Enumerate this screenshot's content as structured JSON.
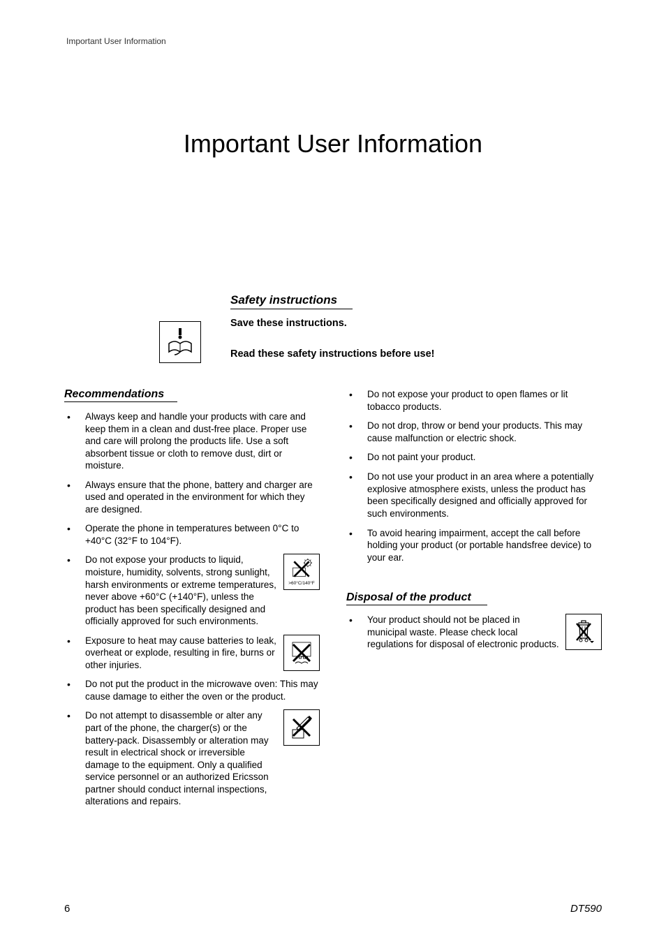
{
  "header": {
    "text": "Important User Information"
  },
  "title": "Important User Information",
  "safety": {
    "heading": "Safety instructions",
    "save": "Save these instructions.",
    "read": "Read these safety instructions before use!"
  },
  "icons": {
    "book": "book-warning-icon",
    "temp": "no-extreme-temperature-icon",
    "temp_caption": ">60°C/140°F",
    "heat": "no-heat-icon",
    "disassemble": "no-disassemble-icon",
    "bin": "crossed-out-bin-icon"
  },
  "recommendations": {
    "heading": "Recommendations",
    "items": [
      "Always keep and handle your products with care and keep them in a clean and dust-free place. Proper use and care will prolong the products life. Use a soft absorbent tissue or cloth to remove dust, dirt or moisture.",
      "Always ensure that the phone, battery and charger are used and operated in the environment for which they are designed.",
      "Operate the phone in temperatures between 0°C to +40°C (32°F to 104°F).",
      "Do not expose your products to liquid, moisture, humidity, solvents, strong sunlight, harsh environments or extreme temperatures, never above +60°C (+140°F), unless the product has been specifically designed and officially approved for such environments.",
      "Exposure to heat may cause batteries to leak, overheat or explode, resulting in fire, burns or other injuries.",
      "Do not put the product in the microwave oven: This may cause damage to either the oven or the product.",
      "Do not attempt to disassemble or alter any part of the phone, the charger(s) or the battery-pack. Disassembly or alteration may result in electrical shock or irreversible damage to the equipment. Only a qualified service personnel or an authorized Ericsson partner should conduct internal inspections, alterations and repairs."
    ]
  },
  "right_items": [
    "Do not expose your product to open flames or lit tobacco products.",
    "Do not drop, throw or bend your products. This may cause malfunction or electric shock.",
    "Do not paint your product.",
    "Do not use your product in an area where a potentially explosive atmosphere exists, unless the product has been specifically designed and officially approved for such environments.",
    "To avoid hearing impairment, accept the call before holding your product (or portable handsfree device) to your ear."
  ],
  "disposal": {
    "heading": "Disposal of the product",
    "items": [
      "Your product should not be placed in municipal waste. Please check local regulations for disposal of electronic products."
    ]
  },
  "footer": {
    "page": "6",
    "model": "DT590"
  }
}
